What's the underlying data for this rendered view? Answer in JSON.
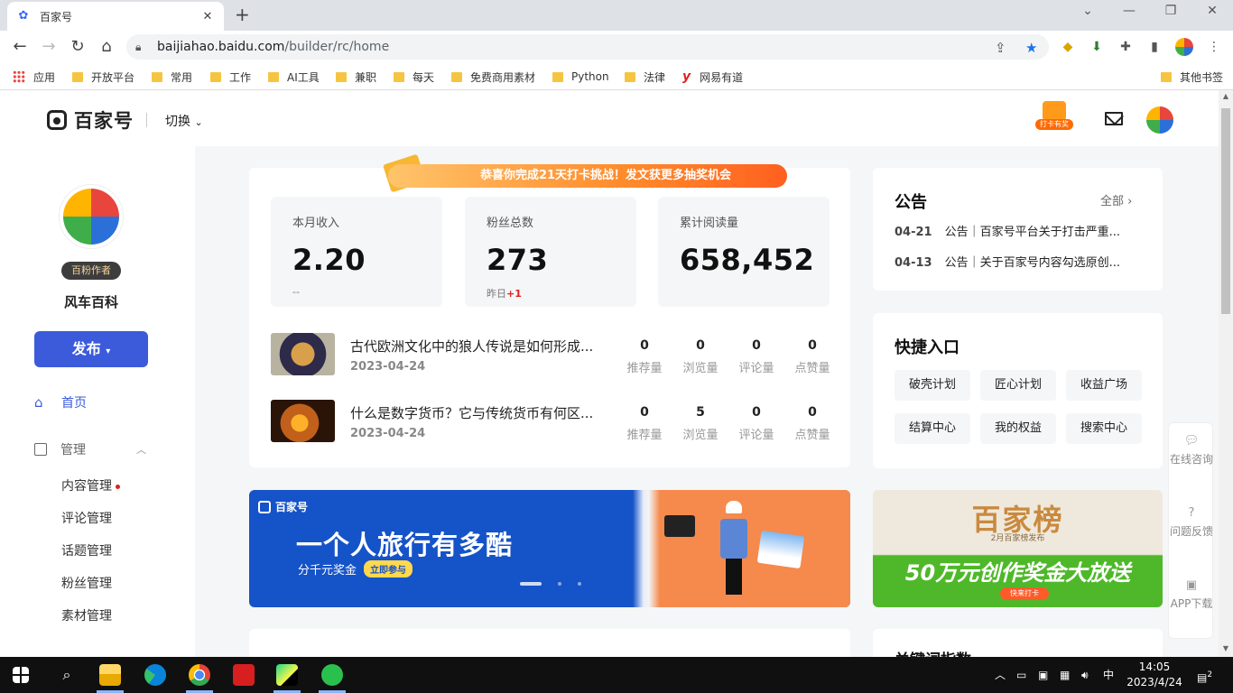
{
  "browser": {
    "tab_title": "百家号",
    "url_host": "baijiahao.baidu.com",
    "url_path": "/builder/rc/home",
    "bookmarks": [
      "应用",
      "开放平台",
      "常用",
      "工作",
      "AI工具",
      "兼职",
      "每天",
      "免费商用素材",
      "Python",
      "法律",
      "网易有道"
    ],
    "other_bookmarks": "其他书签"
  },
  "header": {
    "logo_text": "百家号",
    "switch_label": "切换",
    "gift_label": "打卡有奖"
  },
  "sidebar": {
    "badge": "百粉作者",
    "username": "风车百科",
    "publish_label": "发布",
    "home_label": "首页",
    "group_label": "管理",
    "sub_items": [
      "内容管理",
      "评论管理",
      "话题管理",
      "粉丝管理",
      "素材管理"
    ]
  },
  "dashboard": {
    "congrats": "恭喜你完成21天打卡挑战！发文获更多抽奖机会",
    "stats": [
      {
        "label": "本月收入",
        "value": "2.20",
        "sub": "--"
      },
      {
        "label": "粉丝总数",
        "value": "273",
        "sub_prefix": "昨日",
        "sub_delta": "+1"
      },
      {
        "label": "累计阅读量",
        "value": "658,452"
      }
    ],
    "metric_labels": [
      "推荐量",
      "浏览量",
      "评论量",
      "点赞量"
    ],
    "articles": [
      {
        "title": "古代欧洲文化中的狼人传说是如何形成...",
        "date": "2023-04-24",
        "metrics": [
          "0",
          "0",
          "0",
          "0"
        ]
      },
      {
        "title": "什么是数字货币？它与传统货币有何区...",
        "date": "2023-04-24",
        "metrics": [
          "0",
          "5",
          "0",
          "0"
        ]
      }
    ]
  },
  "banner_main": {
    "logo": "百家号",
    "headline": "一个人旅行有多酷",
    "subline": "分千元奖金",
    "button": "立即参与"
  },
  "banner_side": {
    "title": "百家榜",
    "subtitle": "2月百家榜发布",
    "headline": "50万元创作奖金大放送",
    "button": "快来打卡"
  },
  "notice": {
    "title": "公告",
    "all_label": "全部",
    "items": [
      {
        "date": "04-21",
        "text": "公告｜百家号平台关于打击严重..."
      },
      {
        "date": "04-13",
        "text": "公告｜关于百家号内容勾选原创..."
      }
    ]
  },
  "quick": {
    "title": "快捷入口",
    "items": [
      "破壳计划",
      "匠心计划",
      "收益广场",
      "结算中心",
      "我的权益",
      "搜索中心"
    ]
  },
  "float_panel": {
    "items": [
      "在线咨询",
      "问题反馈",
      "APP下载"
    ]
  },
  "bottom": {
    "right_title": "关键词指数"
  },
  "taskbar": {
    "time": "14:05",
    "date": "2023/4/24",
    "ime": "中",
    "notifications": "2"
  }
}
